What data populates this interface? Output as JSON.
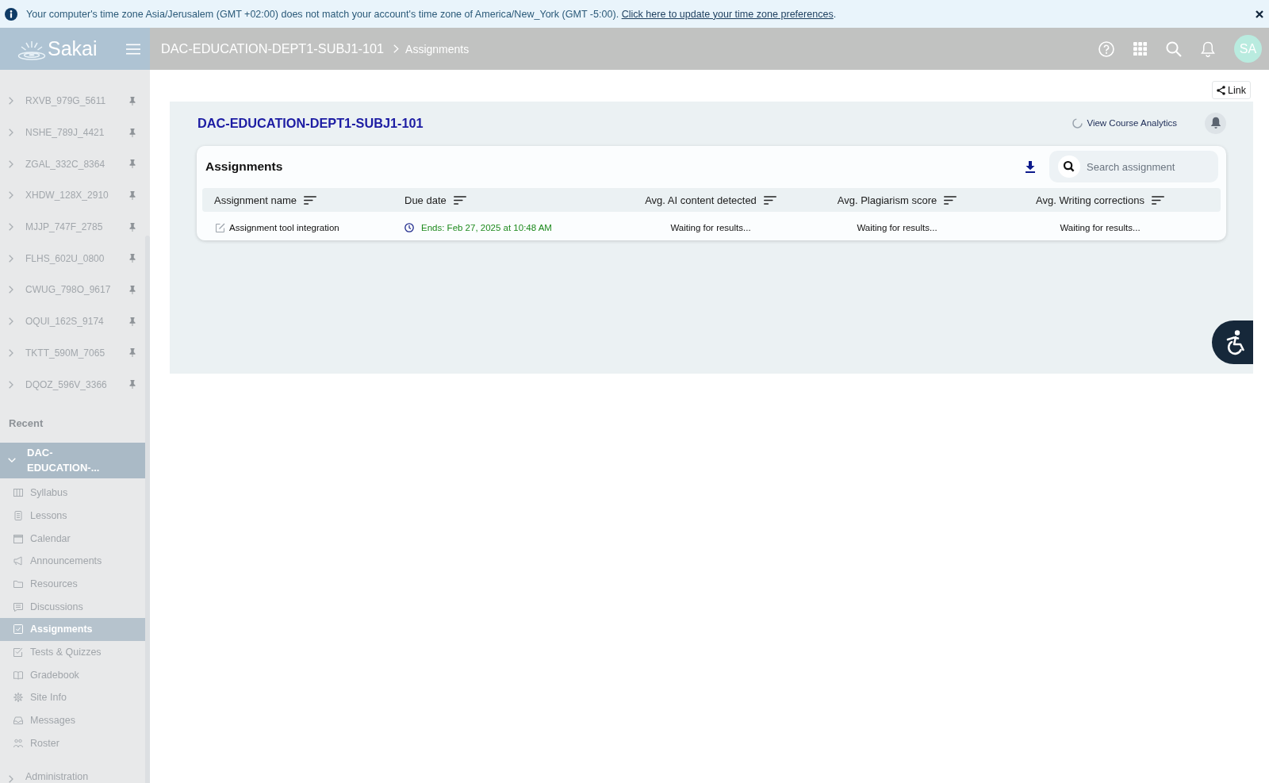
{
  "banner": {
    "message": "Your computer's time zone Asia/Jerusalem (GMT +02:00) does not match your account's time zone of America/New_York (GMT -5:00).",
    "link": "Click here to update your time zone preferences",
    "suffix": "."
  },
  "header": {
    "logo": "Sakai",
    "breadcrumb": {
      "site": "DAC-EDUCATION-DEPT1-SUBJ1-101",
      "page": "Assignments"
    },
    "avatar": "SA"
  },
  "sidebar": {
    "sites": [
      {
        "label": "RXVB_979G_5611",
        "expanded": false
      },
      {
        "label": "NSHE_789J_4421",
        "expanded": false
      },
      {
        "label": "ZGAL_332C_8364",
        "expanded": false
      },
      {
        "label": "XHDW_128X_2910",
        "expanded": false
      },
      {
        "label": "MJJP_747F_2785",
        "expanded": false
      },
      {
        "label": "FLHS_602U_0800",
        "expanded": false
      },
      {
        "label": "CWUG_798O_9617",
        "expanded": false
      },
      {
        "label": "OQUI_162S_9174",
        "expanded": false
      },
      {
        "label": "TKTT_590M_7065",
        "expanded": false
      },
      {
        "label": "DQOZ_596V_3366",
        "expanded": false
      }
    ],
    "recent_heading": "Recent",
    "current_site": {
      "label": "DAC-EDUCATION-...",
      "expanded": true,
      "tools": [
        {
          "label": "Syllabus",
          "kind": "syllabus",
          "selected": false
        },
        {
          "label": "Lessons",
          "kind": "lessons",
          "selected": false
        },
        {
          "label": "Calendar",
          "kind": "calendar",
          "selected": false
        },
        {
          "label": "Announcements",
          "kind": "announcements",
          "selected": false
        },
        {
          "label": "Resources",
          "kind": "resources",
          "selected": false
        },
        {
          "label": "Discussions",
          "kind": "discussions",
          "selected": false
        },
        {
          "label": "Assignments",
          "kind": "assignments",
          "selected": true
        },
        {
          "label": "Tests & Quizzes",
          "kind": "tests",
          "selected": false
        },
        {
          "label": "Gradebook",
          "kind": "gradebook",
          "selected": false
        },
        {
          "label": "Site Info",
          "kind": "siteinfo",
          "selected": false
        },
        {
          "label": "Messages",
          "kind": "messages",
          "selected": false
        },
        {
          "label": "Roster",
          "kind": "roster",
          "selected": false
        }
      ]
    },
    "more_sections": [
      {
        "label": "Administration",
        "expanded": false
      }
    ]
  },
  "main": {
    "link_button": "Link",
    "panel": {
      "title": "DAC-EDUCATION-DEPT1-SUBJ1-101",
      "analytics_link": "View Course Analytics",
      "card": {
        "title": "Assignments",
        "search": {
          "placeholder": "Search assignment"
        },
        "columns": [
          {
            "label": "Assignment name"
          },
          {
            "label": "Due date"
          },
          {
            "label": "Avg. AI content detected"
          },
          {
            "label": "Avg. Plagiarism score"
          },
          {
            "label": "Avg. Writing corrections"
          }
        ],
        "rows": [
          {
            "name": "Assignment tool integration",
            "due": "Ends: Feb 27, 2025 at 10:48 AM",
            "ai_content": "Waiting for results...",
            "plagiarism": "Waiting for results...",
            "writing": "Waiting for results..."
          }
        ]
      }
    }
  }
}
